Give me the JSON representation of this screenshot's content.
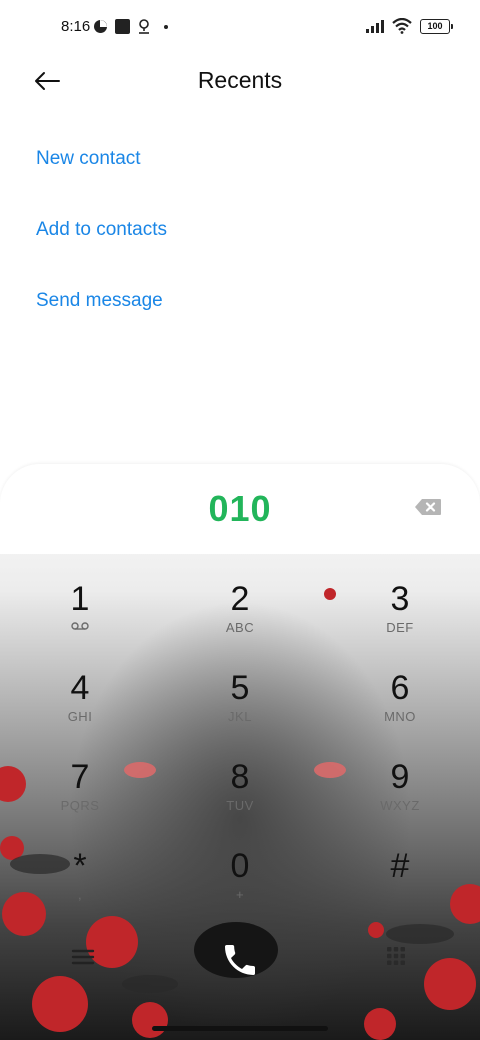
{
  "status_bar": {
    "time": "8:16",
    "battery": "100",
    "icons": [
      "dark-mode-icon",
      "square-icon",
      "location-icon",
      "dot-icon",
      "signal-icon",
      "wifi-icon",
      "battery-icon"
    ]
  },
  "header": {
    "title": "Recents",
    "back_icon": "arrow-left-icon"
  },
  "actions": {
    "new_contact": "New contact",
    "add_to_contacts": "Add to contacts",
    "send_message": "Send message"
  },
  "dialer": {
    "number": "010",
    "accent_color": "#22b55a",
    "keys": [
      {
        "digit": "1",
        "letters": ""
      },
      {
        "digit": "2",
        "letters": "ABC"
      },
      {
        "digit": "3",
        "letters": "DEF"
      },
      {
        "digit": "4",
        "letters": "GHI"
      },
      {
        "digit": "5",
        "letters": "JKL"
      },
      {
        "digit": "6",
        "letters": "MNO"
      },
      {
        "digit": "7",
        "letters": "PQRS"
      },
      {
        "digit": "8",
        "letters": "TUV"
      },
      {
        "digit": "9",
        "letters": "WXYZ"
      },
      {
        "digit": "*",
        "letters": ","
      },
      {
        "digit": "0",
        "letters": "+"
      },
      {
        "digit": "#",
        "letters": ""
      }
    ]
  },
  "colors": {
    "link": "#1a86e6",
    "call": "#ffffff"
  }
}
